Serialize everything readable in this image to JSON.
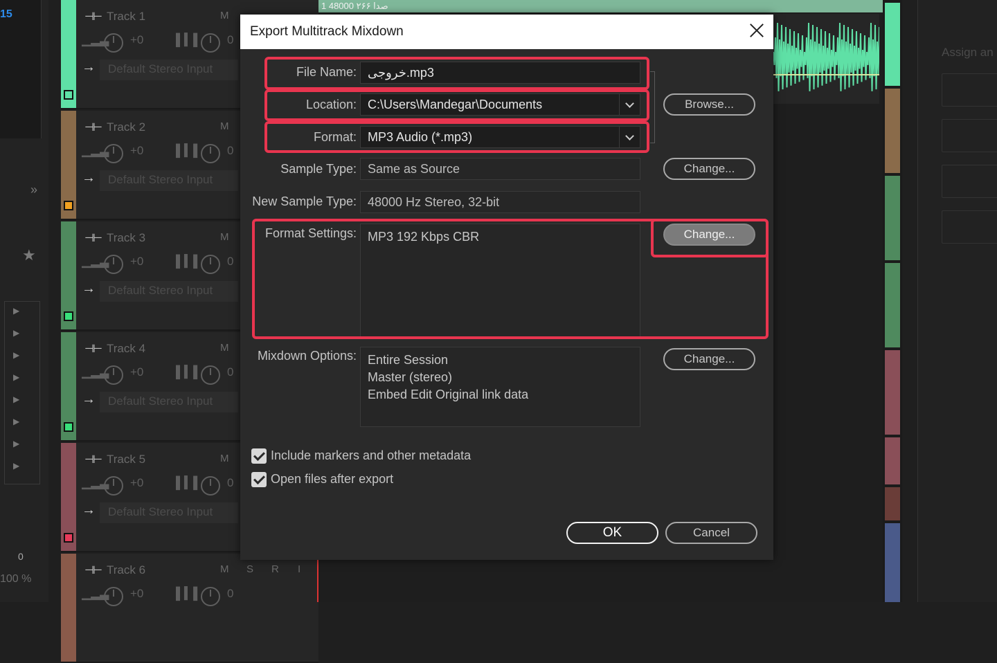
{
  "background": {
    "left_number": "15",
    "left_arrows": "»",
    "left_star": "★",
    "left_zero": "0",
    "left_zoom": "100 %",
    "clip_header": "1 48000 ۲۶۶ صدا",
    "right_panel_label": "Assign an",
    "tracks": [
      {
        "name": "Track 1",
        "m": "M",
        "vol": "+0",
        "pan": "0",
        "input": "Default Stereo Input",
        "color": "#5fe0a6",
        "chip": "#5fe0a6"
      },
      {
        "name": "Track 2",
        "m": "M",
        "vol": "+0",
        "pan": "0",
        "input": "Default Stereo Input",
        "color": "#8a6b4a",
        "chip": "#f0a020"
      },
      {
        "name": "Track 3",
        "m": "M",
        "vol": "+0",
        "pan": "0",
        "input": "Default Stereo Input",
        "color": "#4f8a5e",
        "chip": "#38e07a"
      },
      {
        "name": "Track 4",
        "m": "M",
        "vol": "+0",
        "pan": "0",
        "input": "Default Stereo Input",
        "color": "#4f8a5e",
        "chip": "#38e07a"
      },
      {
        "name": "Track 5",
        "m": "M",
        "vol": "+0",
        "pan": "0",
        "input": "Default Stereo Input",
        "color": "#8a4f58",
        "chip": "#e83a5a"
      },
      {
        "name": "Track 6",
        "m": "M",
        "vol": "+0",
        "pan": "0",
        "input": "",
        "color": "#8a5a4a",
        "chip": ""
      }
    ],
    "track6_controls": {
      "s": "S",
      "r": "R",
      "i": "I"
    }
  },
  "dialog": {
    "title": "Export Multitrack Mixdown",
    "file_name_label": "File Name:",
    "file_name_value": "خروجی.mp3",
    "location_label": "Location:",
    "location_value": "C:\\Users\\Mandegar\\Documents",
    "browse_label": "Browse...",
    "format_label": "Format:",
    "format_value": "MP3 Audio (*.mp3)",
    "sample_type_label": "Sample Type:",
    "sample_type_value": "Same as Source",
    "sample_change_label": "Change...",
    "new_sample_type_label": "New Sample Type:",
    "new_sample_type_value": "48000 Hz Stereo, 32-bit",
    "format_settings_label": "Format Settings:",
    "format_settings_value": "MP3 192 Kbps CBR",
    "format_change_label": "Change...",
    "mixdown_label": "Mixdown Options:",
    "mixdown_lines": [
      "Entire Session",
      "Master (stereo)",
      "Embed Edit Original link data"
    ],
    "mixdown_change_label": "Change...",
    "include_markers_label": "Include markers and other metadata",
    "include_markers_checked": true,
    "open_files_label": "Open files after export",
    "open_files_checked": true,
    "ok_label": "OK",
    "cancel_label": "Cancel"
  },
  "colors": {
    "highlight": "#e8354f",
    "meter_segments": [
      "#5fe0a6",
      "#8a6b4a",
      "#4f8a5e",
      "#4f8a5e",
      "#8a4f58",
      "#8a4f58",
      "#6a3d38",
      "#4a5a8a"
    ]
  }
}
